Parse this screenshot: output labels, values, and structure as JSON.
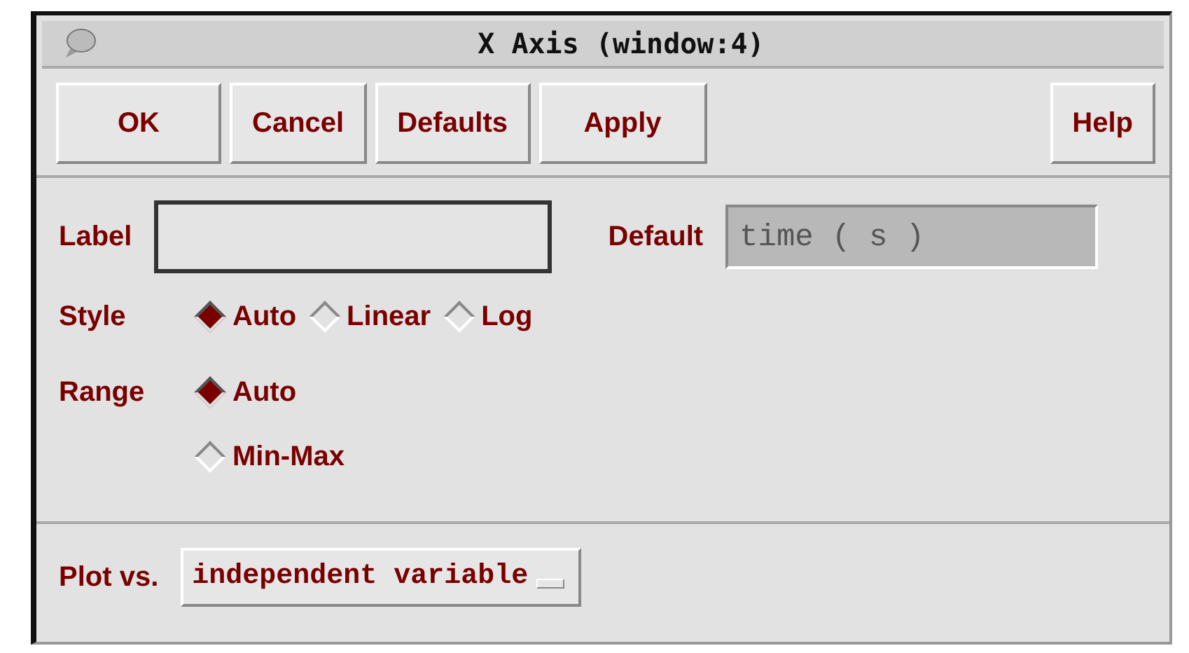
{
  "window": {
    "title": "X Axis (window:4)"
  },
  "buttons": [
    {
      "label": "OK"
    },
    {
      "label": "Cancel"
    },
    {
      "label": "Defaults"
    },
    {
      "label": "Apply"
    },
    {
      "label": "Help"
    }
  ],
  "label_field": {
    "label": "Label"
  },
  "default_field": {
    "label": "Default",
    "value": "time ( s )"
  },
  "style": {
    "label": "Style",
    "options": [
      {
        "label": "Auto",
        "selected": true
      },
      {
        "label": "Linear",
        "selected": false
      },
      {
        "label": "Log",
        "selected": false
      }
    ]
  },
  "range": {
    "label": "Range",
    "options": [
      {
        "label": "Auto",
        "selected": true
      },
      {
        "label": "Min-Max",
        "selected": false
      }
    ]
  },
  "plot_vs": {
    "label": "Plot vs.",
    "value": "independent variable"
  }
}
